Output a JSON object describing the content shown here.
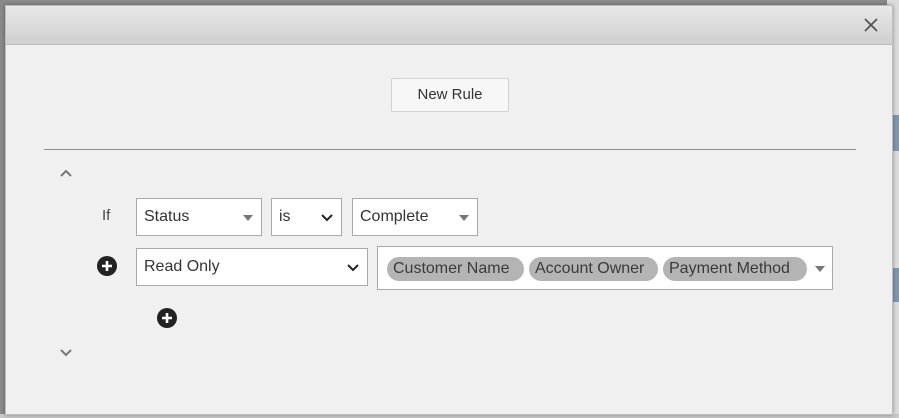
{
  "icons": {
    "close": "close-icon",
    "collapse": "chevron-up-icon",
    "expand": "chevron-down-icon",
    "add": "plus-circle-icon"
  },
  "toolbar": {
    "new_rule_label": "New Rule"
  },
  "rule": {
    "if_label": "If",
    "condition": {
      "field": "Status",
      "operator": "is",
      "value": "Complete"
    },
    "action": {
      "type": "Read Only",
      "fields": [
        "Customer Name",
        "Account Owner",
        "Payment Method"
      ]
    }
  }
}
